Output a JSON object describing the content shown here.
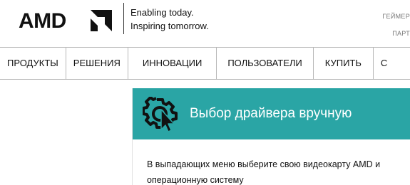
{
  "brand": {
    "logo_text": "AMD",
    "tagline_line1": "Enabling today.",
    "tagline_line2": "Inspiring tomorrow."
  },
  "top_links": [
    "ГЕЙМЕР",
    "ПАРТ"
  ],
  "nav": {
    "items": [
      "ПРОДУКТЫ",
      "РЕШЕНИЯ",
      "ИННОВАЦИИ",
      "ПОЛЬЗОВАТЕЛИ",
      "КУПИТЬ",
      "С"
    ]
  },
  "panel": {
    "title": "Выбор драйвера вручную",
    "icon": "gear-cursor-icon",
    "description": "В выпадающих меню выберите свою видеокарту AMD и операционную систему"
  },
  "colors": {
    "accent": "#2aa5a5",
    "text": "#111111",
    "border": "#b8b8b8"
  }
}
